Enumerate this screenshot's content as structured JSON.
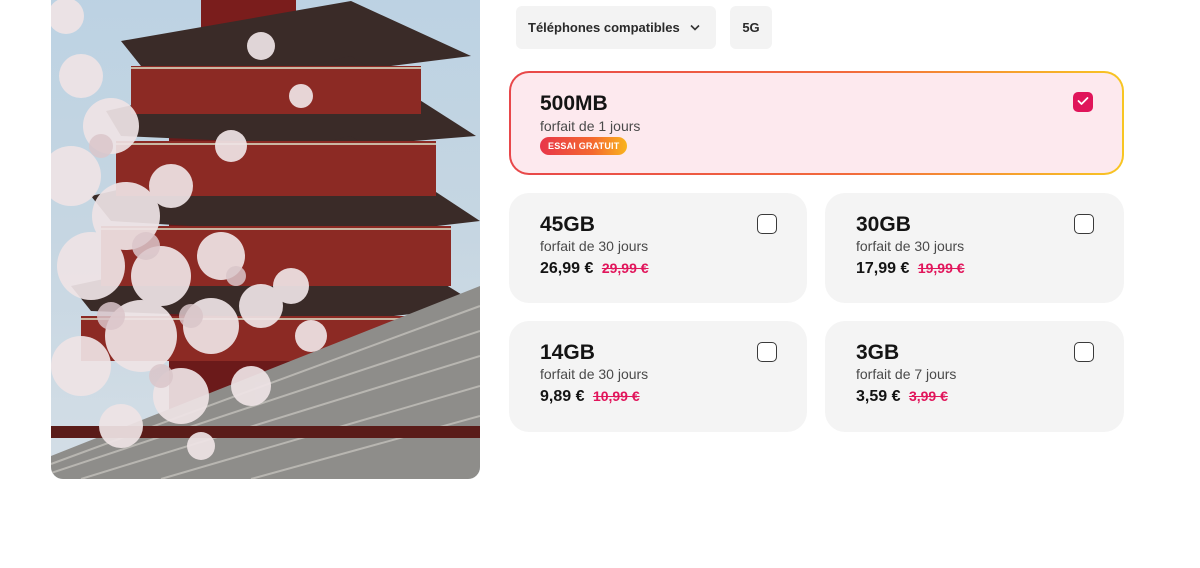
{
  "filters": {
    "compatible_phones": "Téléphones compatibles",
    "network": "5G"
  },
  "featured_plan": {
    "data": "500MB",
    "duration": "forfait de 1 jours",
    "badge": "ESSAI GRATUIT",
    "selected": true
  },
  "plans": [
    {
      "data": "45GB",
      "duration": "forfait de 30 jours",
      "price": "26,99 €",
      "old_price": "29,99 €",
      "selected": false
    },
    {
      "data": "30GB",
      "duration": "forfait de 30 jours",
      "price": "17,99 €",
      "old_price": "19,99 €",
      "selected": false
    },
    {
      "data": "14GB",
      "duration": "forfait de 30 jours",
      "price": "9,89 €",
      "old_price": "10,99 €",
      "selected": false
    },
    {
      "data": "3GB",
      "duration": "forfait de 7 jours",
      "price": "3,59 €",
      "old_price": "3,99 €",
      "selected": false
    }
  ],
  "colors": {
    "accent": "#e0155a",
    "card_background": "#f4f4f4",
    "featured_background": "#fde9ee"
  },
  "icons": {
    "chip_chevron": "chevron-down-icon",
    "checkbox_checked": "checkmark-icon"
  }
}
